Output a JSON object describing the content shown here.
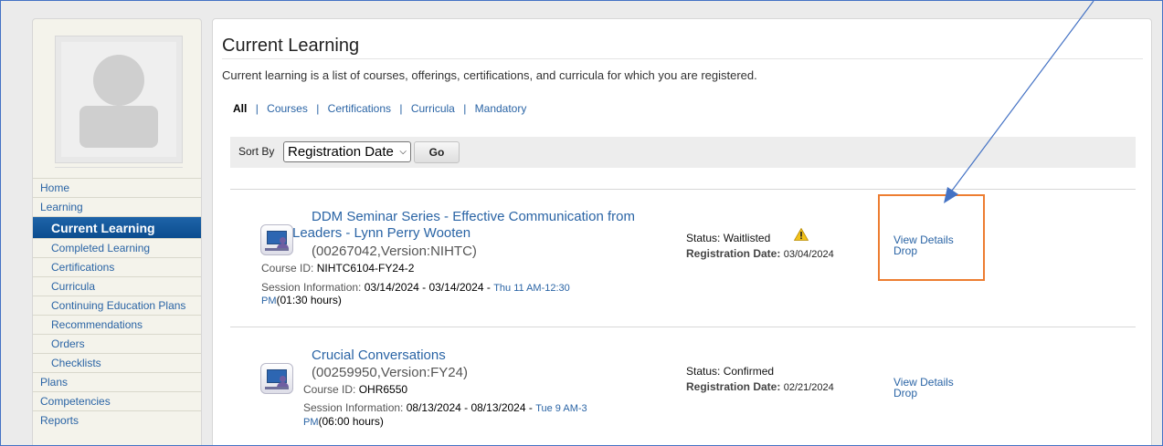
{
  "sidebar": {
    "items": [
      {
        "label": "Home",
        "name": "sidebar-item-home",
        "level": "top"
      },
      {
        "label": "Learning",
        "name": "sidebar-item-learning",
        "level": "top"
      },
      {
        "label": "Current Learning",
        "name": "sidebar-item-current-learning",
        "level": "active"
      },
      {
        "label": "Completed Learning",
        "name": "sidebar-item-completed-learning",
        "level": "sub"
      },
      {
        "label": "Certifications",
        "name": "sidebar-item-certifications",
        "level": "sub"
      },
      {
        "label": "Curricula",
        "name": "sidebar-item-curricula",
        "level": "sub"
      },
      {
        "label": "Continuing Education Plans",
        "name": "sidebar-item-continuing-education-plans",
        "level": "sub"
      },
      {
        "label": "Recommendations",
        "name": "sidebar-item-recommendations",
        "level": "sub"
      },
      {
        "label": "Orders",
        "name": "sidebar-item-orders",
        "level": "sub"
      },
      {
        "label": "Checklists",
        "name": "sidebar-item-checklists",
        "level": "sub"
      },
      {
        "label": "Plans",
        "name": "sidebar-item-plans",
        "level": "top"
      },
      {
        "label": "Competencies",
        "name": "sidebar-item-competencies",
        "level": "top"
      },
      {
        "label": "Reports",
        "name": "sidebar-item-reports",
        "level": "top"
      }
    ]
  },
  "main": {
    "title": "Current Learning",
    "description": "Current learning is a list of courses, offerings, certifications, and curricula for which you are registered.",
    "filters": {
      "all": "All",
      "sep": "|",
      "courses": "Courses",
      "certifications": "Certifications",
      "curricula": "Curricula",
      "mandatory": "Mandatory"
    },
    "sort": {
      "label": "Sort By",
      "selected": "Registration Date",
      "go_label": "Go"
    },
    "courses": [
      {
        "title_line1": "DDM Seminar Series - Effective Communication from",
        "title_line2": "Leaders - Lynn Perry Wooten",
        "code": "(00267042,Version:NIHTC)",
        "course_id_label": "Course ID:",
        "course_id": "NIHTC6104-FY24-2",
        "session_label": "Session Information:",
        "session_dates": "03/14/2024 - 03/14/2024 -",
        "session_time_1": "Thu 11 AM-12:30",
        "session_time_2": "PM",
        "session_hours": "(01:30 hours)",
        "status": "Status: Waitlisted",
        "reg_label": "Registration Date:",
        "reg_date": "03/04/2024",
        "view_details": "View Details",
        "drop": "Drop"
      },
      {
        "title_line1": "Crucial Conversations",
        "code": "(00259950,Version:FY24)",
        "course_id_label": "Course ID:",
        "course_id": "OHR6550",
        "session_label": "Session Information:",
        "session_dates": "08/13/2024 - 08/13/2024 -",
        "session_time_1": "Tue 9 AM-3",
        "session_time_2": "PM",
        "session_hours": "(06:00 hours)",
        "status": "Status: Confirmed",
        "reg_label": "Registration Date:",
        "reg_date": "02/21/2024",
        "view_details": "View Details",
        "drop": "Drop"
      }
    ]
  },
  "colors": {
    "link": "#2a64a5",
    "active_nav": "#0b4d8f",
    "highlight": "#ed7d31",
    "arrow": "#4472c4",
    "warning": "#f2c21b"
  }
}
